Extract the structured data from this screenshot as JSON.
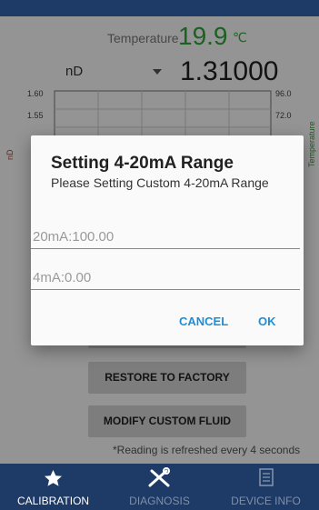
{
  "status_bar": {},
  "temperature": {
    "label": "Temperature",
    "value": "19.9",
    "unit": "℃"
  },
  "measure": {
    "selected": "nD",
    "value": "1.31000"
  },
  "chart_data": {
    "type": "line",
    "left_axis_label": "nD",
    "right_axis_label": "Temperature",
    "left_ticks": [
      "1.60",
      "1.55"
    ],
    "right_ticks": [
      "96.0",
      "72.0"
    ],
    "colors": {
      "left_axis": "#c0392b",
      "right_axis": "#2fa83a",
      "grid": "#d0d0d0"
    }
  },
  "buttons": {
    "restore": "RESTORE TO FACTORY",
    "modify": "MODIFY CUSTOM FLUID"
  },
  "refresh_note": "*Reading is refreshed every 4 seconds",
  "bottom_nav": {
    "items": [
      {
        "label": "CALIBRATION",
        "icon": "star-icon",
        "active": true
      },
      {
        "label": "DIAGNOSIS",
        "icon": "tools-icon",
        "active": false
      },
      {
        "label": "DEVICE INFO",
        "icon": "document-icon",
        "active": false
      }
    ]
  },
  "dialog": {
    "title": "Setting 4-20mA Range",
    "message": "Please Setting Custom 4-20mA Range",
    "field_20ma": {
      "value": "",
      "placeholder": "20mA:100.00"
    },
    "field_4ma": {
      "value": "",
      "placeholder": "4mA:0.00"
    },
    "cancel": "CANCEL",
    "ok": "OK"
  },
  "colors": {
    "primary": "#1e3a66",
    "accent": "#1e8fd6",
    "temperature": "#2fa83a"
  }
}
